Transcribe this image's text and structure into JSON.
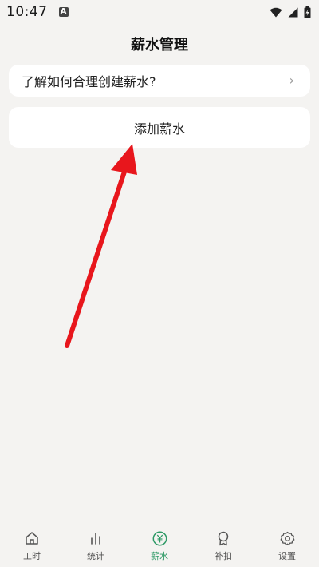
{
  "status_bar": {
    "time": "10:47",
    "notification_icon": "a-icon",
    "indicators": [
      "wifi-icon",
      "signal-icon",
      "battery-icon"
    ]
  },
  "header": {
    "title": "薪水管理"
  },
  "main": {
    "help_card": {
      "label": "了解如何合理创建薪水?",
      "chevron": "›"
    },
    "add_salary_button": {
      "label": "添加薪水"
    }
  },
  "annotation": {
    "type": "red-arrow",
    "color": "#e8161c",
    "points_to": "add_salary_button"
  },
  "bottom_nav": {
    "items": [
      {
        "label": "工时",
        "icon": "home-icon",
        "active": false
      },
      {
        "label": "统计",
        "icon": "bar-chart-icon",
        "active": false
      },
      {
        "label": "薪水",
        "icon": "yen-icon",
        "active": true
      },
      {
        "label": "补扣",
        "icon": "badge-icon",
        "active": false
      },
      {
        "label": "设置",
        "icon": "gear-icon",
        "active": false
      }
    ]
  },
  "colors": {
    "background": "#f4f3f1",
    "card": "#ffffff",
    "accent": "#2f9a67",
    "arrow": "#e8161c"
  }
}
